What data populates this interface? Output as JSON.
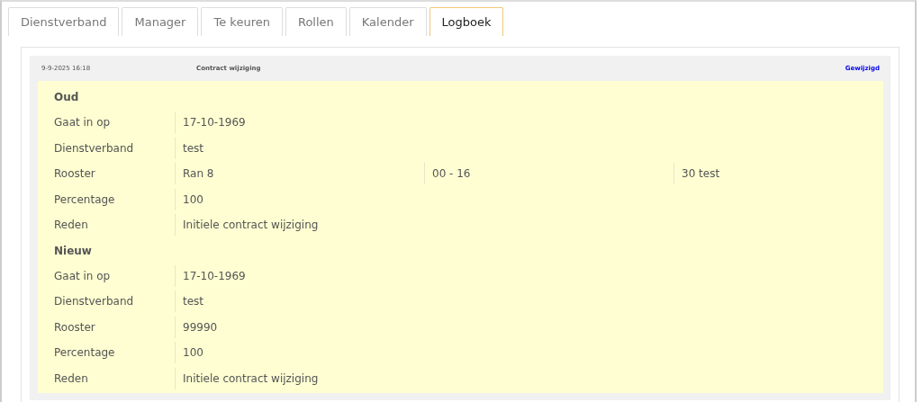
{
  "tabs": [
    {
      "label": "Dienstverband",
      "selected": false
    },
    {
      "label": "Manager",
      "selected": false
    },
    {
      "label": "Te keuren",
      "selected": false
    },
    {
      "label": "Rollen",
      "selected": false
    },
    {
      "label": "Kalender",
      "selected": false
    },
    {
      "label": "Logboek",
      "selected": true
    }
  ],
  "log_entry": {
    "timestamp": "9-9-2025 16:18",
    "subject": "Contract wijziging",
    "action": "Gewijzigd",
    "sections": [
      {
        "heading": "Oud",
        "rows": [
          {
            "label": "Gaat in op",
            "values": [
              "17-10-1969"
            ]
          },
          {
            "label": "Dienstverband",
            "values": [
              "test"
            ]
          },
          {
            "label": "Rooster",
            "values": [
              "Ran 8",
              "00 - 16",
              "30 test"
            ]
          },
          {
            "label": "Percentage",
            "values": [
              "100"
            ]
          },
          {
            "label": "Reden",
            "values": [
              "Initiele contract wijziging"
            ]
          }
        ]
      },
      {
        "heading": "Nieuw",
        "rows": [
          {
            "label": "Gaat in op",
            "values": [
              "17-10-1969"
            ]
          },
          {
            "label": "Dienstverband",
            "values": [
              "test"
            ]
          },
          {
            "label": "Rooster",
            "values": [
              "99990"
            ]
          },
          {
            "label": "Percentage",
            "values": [
              "100"
            ]
          },
          {
            "label": "Reden",
            "values": [
              "Initiele contract wijziging"
            ]
          }
        ]
      }
    ]
  }
}
